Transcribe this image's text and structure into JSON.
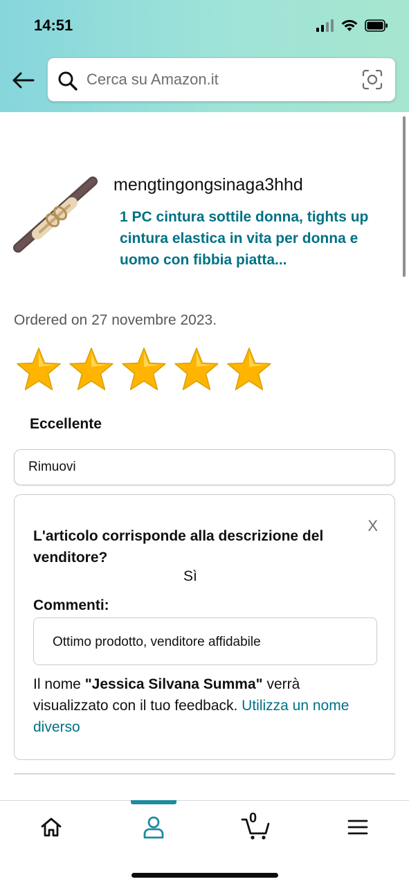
{
  "status_bar": {
    "time": "14:51"
  },
  "search": {
    "placeholder": "Cerca su Amazon.it"
  },
  "product": {
    "seller": "mengtingongsinaga3hhd",
    "title": "1 PC cintura sottile donna, tights up cintura elastica in vita per donna e uomo con fibbia piatta...",
    "ordered_text": "Ordered on 27 novembre 2023."
  },
  "rating": {
    "value": 5,
    "max": 5,
    "label": "Eccellente",
    "star_color": "#ffb400"
  },
  "remove_label": "Rimuovi",
  "feedback": {
    "close_label": "X",
    "question": "L'articolo corrisponde alla descrizione del venditore?",
    "answer": "Sì",
    "comments_label": "Commenti:",
    "comment_value": "Ottimo prodotto, venditore affidabile",
    "note_prefix": "Il nome ",
    "note_name": "\"Jessica Silvana Summa\"",
    "note_suffix": " verrà visualizzato con il tuo feedback. ",
    "note_link": "Utilizza un nome diverso"
  },
  "bottom_nav": {
    "items": [
      "home",
      "account",
      "cart",
      "menu"
    ],
    "active": "account",
    "cart_count": "0",
    "accent": "#1e8ba0"
  },
  "colors": {
    "link": "#007185",
    "header_gradient_start": "#86d6dc",
    "header_gradient_end": "#a6e6cf"
  }
}
